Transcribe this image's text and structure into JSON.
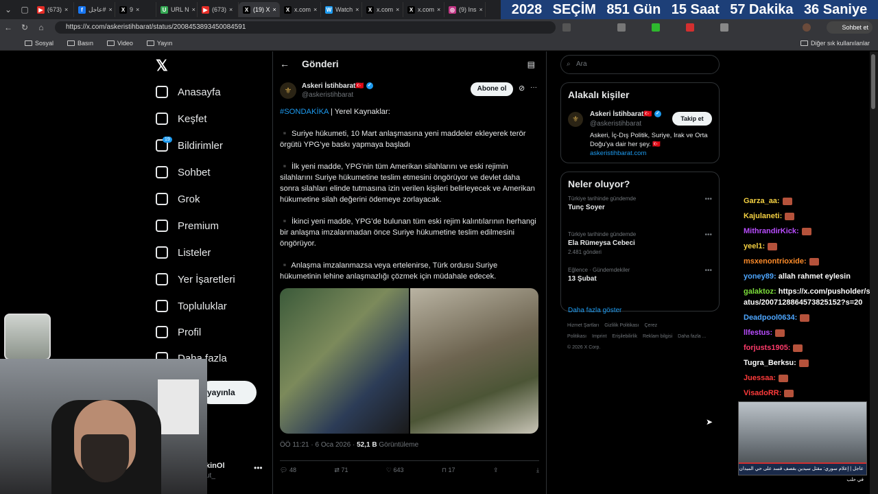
{
  "browser": {
    "tabs": [
      {
        "label": "(673)",
        "color": "#e52d27",
        "glyph": "▶"
      },
      {
        "label": "عاجل#",
        "color": "#1877f2",
        "glyph": "f"
      },
      {
        "label": "9",
        "color": "#000000",
        "glyph": "X"
      },
      {
        "label": "URL N",
        "color": "#34a853",
        "glyph": "U"
      },
      {
        "label": "(673)",
        "color": "#e52d27",
        "glyph": "▶"
      },
      {
        "label": "(19) X",
        "color": "#000000",
        "glyph": "X",
        "active": true
      },
      {
        "label": "x.com",
        "color": "#000000",
        "glyph": "X"
      },
      {
        "label": "Watch",
        "color": "#1d9bf0",
        "glyph": "W"
      },
      {
        "label": "x.com",
        "color": "#000000",
        "glyph": "X"
      },
      {
        "label": "x.com",
        "color": "#000000",
        "glyph": "X"
      },
      {
        "label": "(9) Ins",
        "color": "#c13584",
        "glyph": "◎"
      }
    ],
    "url": "https://x.com/askeristihbarat/status/2008453893450084591",
    "profile_chat_label": "Sohbet et",
    "bookmarks": [
      "Sosyal",
      "Basın",
      "Video",
      "Yayın"
    ],
    "other_bookmarks": "Diğer sık kullanılanlar"
  },
  "countdown": {
    "year": "2028",
    "word": "SEÇİM",
    "days": "851 Gün",
    "hours": "15 Saat",
    "minutes": "57 Dakika",
    "seconds": "36 Saniye"
  },
  "nav": {
    "items": [
      "Anasayfa",
      "Keşfet",
      "Bildirimler",
      "Sohbet",
      "Grok",
      "Premium",
      "Listeler",
      "Yer İşaretleri",
      "Topluluklar",
      "Profil",
      "Daha fazla"
    ],
    "notif_badge": "19",
    "post_button": "yayınla",
    "account_name": "kinOl",
    "account_handle": "ut_"
  },
  "post": {
    "header": "Gönderi",
    "author": "Askeri İstihbarat",
    "author_flag": "🇹🇷",
    "handle": "@askeristihbarat",
    "subscribe": "Abone ol",
    "hashtag": "#SONDAKİKA",
    "intro": " | Yerel Kaynaklar:",
    "paragraphs": [
      "▪️ Suriye hükumeti, 10 Mart anlaşmasına yeni maddeler ekleyerek terör örgütü YPG’ye baskı yapmaya başladı",
      "▪️ İlk yeni madde, YPG’nin tüm Amerikan silahlarını ve eski rejimin silahlarını Suriye hükumetine teslim etmesini öngörüyor ve devlet daha sonra silahları elinde tutmasına izin verilen kişileri belirleyecek ve Amerikan hükumetine silah değerini ödemeye zorlayacak.",
      "▪️ İkinci yeni madde, YPG’de bulunan tüm eski rejim kalıntılarının herhangi bir anlaşma imzalanmadan önce Suriye hükumetine teslim edilmesini öngörüyor.",
      "▪️ Anlaşma imzalanmazsa veya ertelenirse, Türk ordusu Suriye hükumetinin lehine anlaşmazlığı çözmek için müdahale edecek."
    ],
    "time": "ÖÖ 11:21 · 6 Oca 2026 · ",
    "views": "52,1 B",
    "views_label": " Görüntüleme",
    "replies": "48",
    "reposts": "71",
    "likes": "643",
    "bookmarks": "17"
  },
  "sidebar": {
    "search_placeholder": "Ara",
    "related_title": "Alakalı kişiler",
    "related_name": "Askeri İstihbarat",
    "related_handle": "@askeristihbarat",
    "related_bio": "Askeri, İç-Dış Politik, Suriye, Irak ve Orta Doğu'ya dair her şey. 🇹🇷",
    "related_link": "askeristihbarat.com",
    "follow": "Takip et",
    "trends_title": "Neler oluyor?",
    "trends": [
      {
        "category": "Türkiye tarihinde gündemde",
        "name": "Tunç Soyer",
        "count": ""
      },
      {
        "category": "Türkiye tarihinde gündemde",
        "name": "Ela Rümeysa Cebeci",
        "count": "2.481 gönderi"
      },
      {
        "category": "Eğlence · Gündemdekiler",
        "name": "13 Şubat",
        "count": ""
      }
    ],
    "show_more": "Daha fazla göster",
    "footer_links": [
      "Hizmet Şartları",
      "Gizlilik Politikası",
      "Çerez Politikası",
      "Imprint",
      "Erişilebilirlik",
      "Reklam bilgisi",
      "Daha fazla ..."
    ],
    "copyright": "© 2026 X Corp."
  },
  "chat": [
    {
      "user": "Garza_aa:",
      "color": "#f5d142",
      "text": ""
    },
    {
      "user": "Kajulaneti:",
      "color": "#f5d142",
      "text": ""
    },
    {
      "user": "MithrandirKick:",
      "color": "#b94dff",
      "text": ""
    },
    {
      "user": "yeel1:",
      "color": "#f5d142",
      "text": ""
    },
    {
      "user": "msxenontrioxide:",
      "color": "#ff8c2a",
      "text": ""
    },
    {
      "user": "yoney89:",
      "color": "#4da6ff",
      "text": "allah rahmet eylesin"
    },
    {
      "user": "galaktoz:",
      "color": "#7ddf3b",
      "text": "https://x.com/pusholder/status/2007128864573825152?s=20"
    },
    {
      "user": "Deadpool0634:",
      "color": "#4da6ff",
      "text": ""
    },
    {
      "user": "llfestus:",
      "color": "#b94dff",
      "text": ""
    },
    {
      "user": "forjusts1905:",
      "color": "#ff3b6b",
      "text": ""
    },
    {
      "user": "Tugra_Berksu:",
      "color": "#ffffff",
      "text": ""
    },
    {
      "user": "Juessaa:",
      "color": "#ff3b3b",
      "text": ""
    },
    {
      "user": "VisadoRR:",
      "color": "#ff3b3b",
      "text": ""
    }
  ],
  "video_caption": "عاجل | إعلام سوري: مقتل سيدين بقصف قسد على حي الميدان في حلب"
}
